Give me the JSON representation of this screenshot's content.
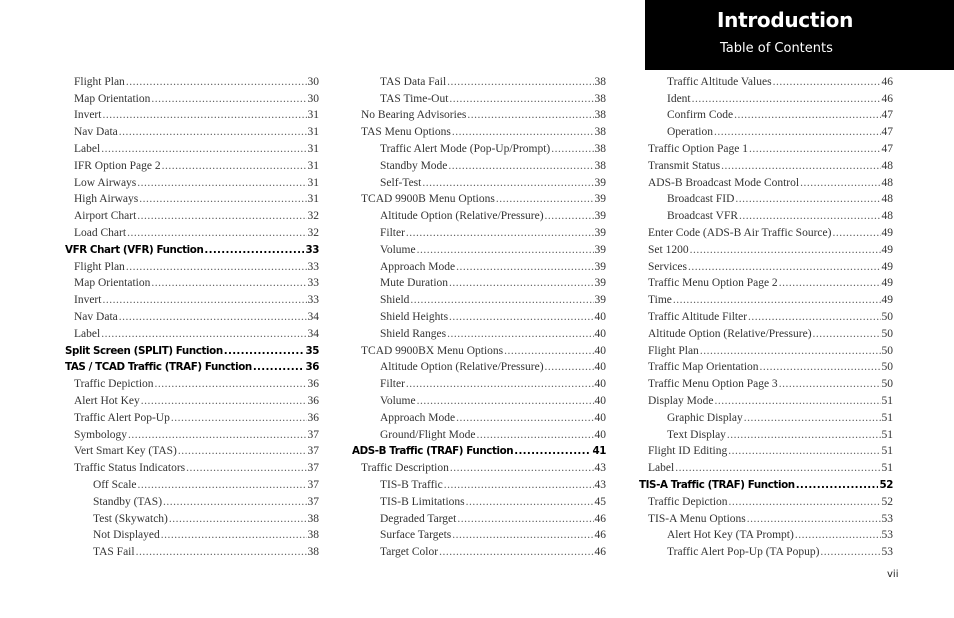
{
  "header": {
    "title": "Introduction",
    "subtitle": "Table of Contents"
  },
  "page_number": "vii",
  "columns": [
    [
      {
        "label": "Flight Plan",
        "page": "30",
        "level": 1
      },
      {
        "label": "Map Orientation",
        "page": "30",
        "level": 1
      },
      {
        "label": "Invert",
        "page": "31",
        "level": 1
      },
      {
        "label": "Nav Data",
        "page": "31",
        "level": 1
      },
      {
        "label": "Label",
        "page": "31",
        "level": 1
      },
      {
        "label": "IFR Option Page 2",
        "page": "31",
        "level": 1
      },
      {
        "label": "Low Airways",
        "page": "31",
        "level": 1
      },
      {
        "label": "High Airways",
        "page": "31",
        "level": 1
      },
      {
        "label": "Airport Chart",
        "page": "32",
        "level": 1
      },
      {
        "label": "Load Chart",
        "page": "32",
        "level": 1
      },
      {
        "label": "VFR Chart (VFR) Function",
        "page": "33",
        "level": "bold"
      },
      {
        "label": "Flight Plan",
        "page": "33",
        "level": 1
      },
      {
        "label": "Map Orientation",
        "page": "33",
        "level": 1
      },
      {
        "label": "Invert",
        "page": "33",
        "level": 1
      },
      {
        "label": "Nav Data",
        "page": "34",
        "level": 1
      },
      {
        "label": "Label",
        "page": "34",
        "level": 1
      },
      {
        "label": "Split Screen (SPLIT) Function",
        "page": "35",
        "level": "bold"
      },
      {
        "label": "TAS / TCAD Traffic (TRAF) Function",
        "page": "36",
        "level": "bold"
      },
      {
        "label": "Traffic Depiction",
        "page": "36",
        "level": 1
      },
      {
        "label": "Alert Hot Key",
        "page": "36",
        "level": 1
      },
      {
        "label": "Traffic Alert Pop-Up",
        "page": "36",
        "level": 1
      },
      {
        "label": "Symbology",
        "page": "37",
        "level": 1
      },
      {
        "label": "Vert Smart Key (TAS)",
        "page": "37",
        "level": 1
      },
      {
        "label": "Traffic Status Indicators",
        "page": "37",
        "level": 1
      },
      {
        "label": "Off Scale",
        "page": "37",
        "level": 2
      },
      {
        "label": "Standby (TAS)",
        "page": "37",
        "level": 2
      },
      {
        "label": "Test (Skywatch)",
        "page": "38",
        "level": 2
      },
      {
        "label": "Not Displayed",
        "page": "38",
        "level": 2
      },
      {
        "label": "TAS Fail",
        "page": "38",
        "level": 2
      }
    ],
    [
      {
        "label": "TAS Data Fail",
        "page": "38",
        "level": 2
      },
      {
        "label": "TAS Time-Out",
        "page": "38",
        "level": 2
      },
      {
        "label": "No Bearing Advisories",
        "page": "38",
        "level": 1
      },
      {
        "label": "TAS Menu Options",
        "page": "38",
        "level": 1
      },
      {
        "label": "Traffic Alert Mode (Pop-Up/Prompt)",
        "page": "38",
        "level": 2
      },
      {
        "label": "Standby Mode",
        "page": "38",
        "level": 2
      },
      {
        "label": "Self-Test",
        "page": "39",
        "level": 2
      },
      {
        "label": "TCAD 9900B Menu Options",
        "page": "39",
        "level": 1
      },
      {
        "label": "Altitude Option (Relative/Pressure)",
        "page": "39",
        "level": 2
      },
      {
        "label": "Filter",
        "page": "39",
        "level": 2
      },
      {
        "label": "Volume",
        "page": "39",
        "level": 2
      },
      {
        "label": "Approach Mode",
        "page": "39",
        "level": 2
      },
      {
        "label": "Mute Duration",
        "page": "39",
        "level": 2
      },
      {
        "label": "Shield",
        "page": "39",
        "level": 2
      },
      {
        "label": "Shield Heights",
        "page": "40",
        "level": 2
      },
      {
        "label": "Shield Ranges",
        "page": "40",
        "level": 2
      },
      {
        "label": "TCAD 9900BX Menu Options",
        "page": "40",
        "level": 1
      },
      {
        "label": "Altitude Option (Relative/Pressure)",
        "page": "40",
        "level": 2
      },
      {
        "label": "Filter",
        "page": "40",
        "level": 2
      },
      {
        "label": "Volume",
        "page": "40",
        "level": 2
      },
      {
        "label": "Approach Mode",
        "page": "40",
        "level": 2
      },
      {
        "label": "Ground/Flight Mode",
        "page": "40",
        "level": 2
      },
      {
        "label": "ADS-B Traffic (TRAF) Function",
        "page": "41",
        "level": "bold"
      },
      {
        "label": "Traffic Description",
        "page": "43",
        "level": 1
      },
      {
        "label": "TIS-B Traffic",
        "page": "43",
        "level": 2
      },
      {
        "label": "TIS-B Limitations",
        "page": "45",
        "level": 2
      },
      {
        "label": "Degraded Target",
        "page": "46",
        "level": 2
      },
      {
        "label": "Surface Targets",
        "page": "46",
        "level": 2
      },
      {
        "label": "Target Color",
        "page": "46",
        "level": 2
      }
    ],
    [
      {
        "label": "Traffic Altitude Values",
        "page": "46",
        "level": 2
      },
      {
        "label": "Ident",
        "page": "46",
        "level": 2
      },
      {
        "label": "Confirm Code",
        "page": "47",
        "level": 2
      },
      {
        "label": "Operation",
        "page": "47",
        "level": 2
      },
      {
        "label": "Traffic Option Page 1",
        "page": "47",
        "level": 1
      },
      {
        "label": "Transmit Status",
        "page": "48",
        "level": 1
      },
      {
        "label": "ADS-B Broadcast Mode Control",
        "page": "48",
        "level": 1
      },
      {
        "label": "Broadcast FID",
        "page": "48",
        "level": 2
      },
      {
        "label": "Broadcast VFR",
        "page": "48",
        "level": 2
      },
      {
        "label": "Enter Code (ADS-B Air Traffic Source)",
        "page": "49",
        "level": 1
      },
      {
        "label": "Set 1200",
        "page": "49",
        "level": 1
      },
      {
        "label": "Services",
        "page": "49",
        "level": 1
      },
      {
        "label": "Traffic Menu Option Page 2",
        "page": "49",
        "level": 1
      },
      {
        "label": "Time",
        "page": "49",
        "level": 1
      },
      {
        "label": "Traffic Altitude Filter",
        "page": "50",
        "level": 1
      },
      {
        "label": "Altitude Option (Relative/Pressure)",
        "page": "50",
        "level": 1
      },
      {
        "label": "Flight Plan",
        "page": "50",
        "level": 1
      },
      {
        "label": "Traffic Map Orientation",
        "page": "50",
        "level": 1
      },
      {
        "label": "Traffic Menu Option Page 3",
        "page": "50",
        "level": 1
      },
      {
        "label": "Display Mode",
        "page": "51",
        "level": 1
      },
      {
        "label": "Graphic Display",
        "page": "51",
        "level": 2
      },
      {
        "label": "Text Display",
        "page": "51",
        "level": 2
      },
      {
        "label": "Flight ID Editing",
        "page": "51",
        "level": 1
      },
      {
        "label": "Label",
        "page": "51",
        "level": 1
      },
      {
        "label": "TIS-A Traffic (TRAF) Function",
        "page": "52",
        "level": "bold"
      },
      {
        "label": "Traffic Depiction",
        "page": "52",
        "level": 1
      },
      {
        "label": "TIS-A Menu Options",
        "page": "53",
        "level": 1
      },
      {
        "label": "Alert Hot Key (TA Prompt)",
        "page": "53",
        "level": 2
      },
      {
        "label": "Traffic Alert Pop-Up (TA Popup)",
        "page": "53",
        "level": 2
      }
    ]
  ]
}
